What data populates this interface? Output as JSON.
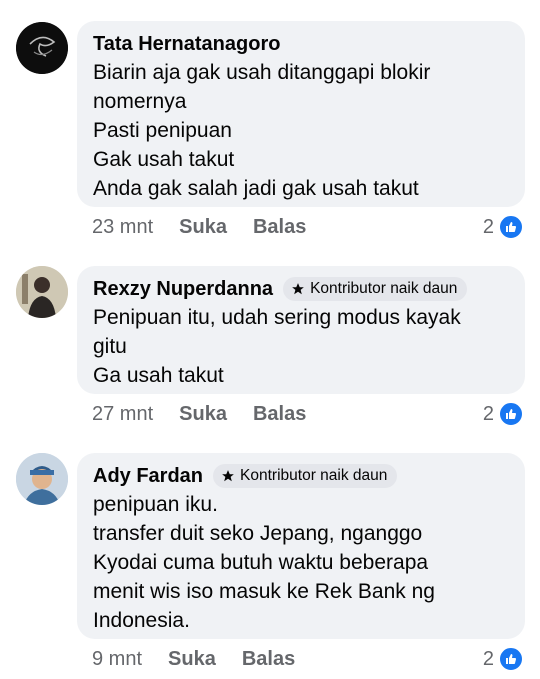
{
  "comments": [
    {
      "author": "Tata Hernatanagoro",
      "badge": "",
      "lines": [
        "Biarin aja gak usah ditanggapi blokir",
        "nomernya",
        "Pasti penipuan",
        "Gak usah takut",
        "Anda gak salah jadi gak usah takut"
      ],
      "time": "23 mnt",
      "like_label": "Suka",
      "reply_label": "Balas",
      "reaction_count": "2",
      "reaction_icon": "like-icon",
      "colors": {
        "reaction": "#1877f2"
      }
    },
    {
      "author": "Rexzy Nuperdanna",
      "badge": "Kontributor naik daun",
      "lines": [
        "Penipuan itu, udah sering modus kayak",
        "gitu",
        "Ga usah takut"
      ],
      "time": "27 mnt",
      "like_label": "Suka",
      "reply_label": "Balas",
      "reaction_count": "2",
      "reaction_icon": "like-icon"
    },
    {
      "author": "Ady Fardan",
      "badge": "Kontributor naik daun",
      "lines": [
        "penipuan iku.",
        "transfer duit seko Jepang, nganggo",
        "Kyodai cuma butuh waktu beberapa",
        "menit wis iso masuk ke Rek Bank ng",
        "Indonesia."
      ],
      "time": "9 mnt",
      "like_label": "Suka",
      "reply_label": "Balas",
      "reaction_count": "2",
      "reaction_icon": "like-icon"
    }
  ]
}
